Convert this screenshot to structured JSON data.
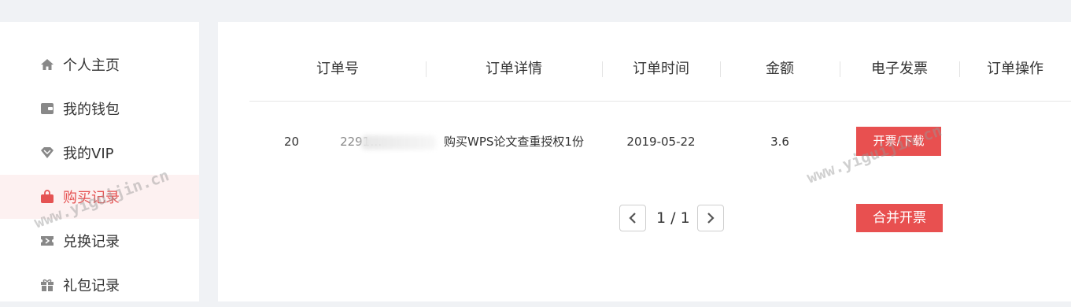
{
  "sidebar": {
    "items": [
      {
        "label": "个人主页",
        "icon": "home-icon"
      },
      {
        "label": "我的钱包",
        "icon": "wallet-icon"
      },
      {
        "label": "我的VIP",
        "icon": "diamond-icon"
      },
      {
        "label": "购买记录",
        "icon": "bag-icon",
        "active": true
      },
      {
        "label": "兑换记录",
        "icon": "ticket-icon"
      },
      {
        "label": "礼包记录",
        "icon": "gift-icon"
      }
    ]
  },
  "table": {
    "headers": [
      "订单号",
      "订单详情",
      "订单时间",
      "金额",
      "电子发票",
      "订单操作"
    ],
    "rows": [
      {
        "order_no_prefix": "20",
        "order_no_suffix": "2291…",
        "detail": "购买WPS论文查重授权1份",
        "time": "2019-05-22",
        "amount": "3.6",
        "invoice_button": "开票/下载"
      }
    ]
  },
  "pager": {
    "text": "1 / 1"
  },
  "merge_invoice_button": "合并开票",
  "watermarks": [
    "www.yiguijin.cn",
    "www.yiguijin.cn"
  ],
  "colors": {
    "accent": "#e85050",
    "active_bg": "#fdf1f1",
    "page_bg": "#f0f2f5"
  }
}
